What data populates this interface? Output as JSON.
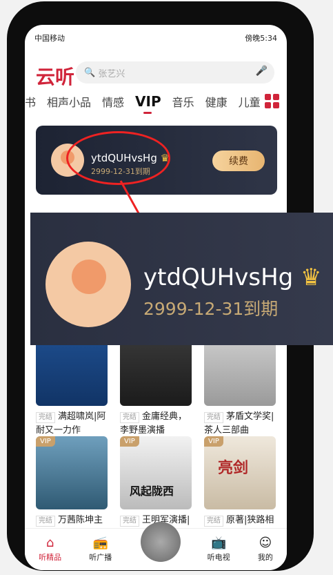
{
  "status_bar": {
    "carrier": "中国移动",
    "time": "傍晚5:34"
  },
  "header": {
    "logo": "云听",
    "search_placeholder": "张艺兴"
  },
  "tabs": [
    "书",
    "相声小品",
    "情感",
    "VIP",
    "音乐",
    "健康",
    "儿童"
  ],
  "vip_card": {
    "username": "ytdQUHvsHg",
    "expiry": "2999-12-31到期",
    "renew_label": "续费"
  },
  "books": [
    {
      "tag": "完结",
      "title": "满超啸岚|阿耐又一力作",
      "vip": false
    },
    {
      "tag": "完结",
      "title": "金庸经典，李野墨演播",
      "vip": false
    },
    {
      "tag": "完结",
      "title": "茅盾文学奖| 茶人三部曲",
      "vip": false
    },
    {
      "tag": "完结",
      "title": "万茜陈坤主演同名谍战大剧",
      "vip": true,
      "vip_label": "VIP"
    },
    {
      "tag": "完结",
      "title": "王明军演播|马伯庸代表作",
      "vip": true,
      "vip_label": "VIP",
      "cover_text": "风起陇西"
    },
    {
      "tag": "完结",
      "title": "原著|狭路相逢勇者胜",
      "vip": true,
      "vip_label": "VIP",
      "cover_text": "亮剑"
    }
  ],
  "bottom_nav": [
    {
      "label": "听精品",
      "icon": "home-icon",
      "active": true
    },
    {
      "label": "听广播",
      "icon": "radio-icon",
      "active": false
    },
    {
      "label": "听电视",
      "icon": "tv-icon",
      "active": false
    },
    {
      "label": "我的",
      "icon": "profile-icon",
      "active": false
    }
  ],
  "colors": {
    "brand": "#d0243a",
    "card_bg": "#1d2333",
    "gold": "#c8aa75"
  }
}
